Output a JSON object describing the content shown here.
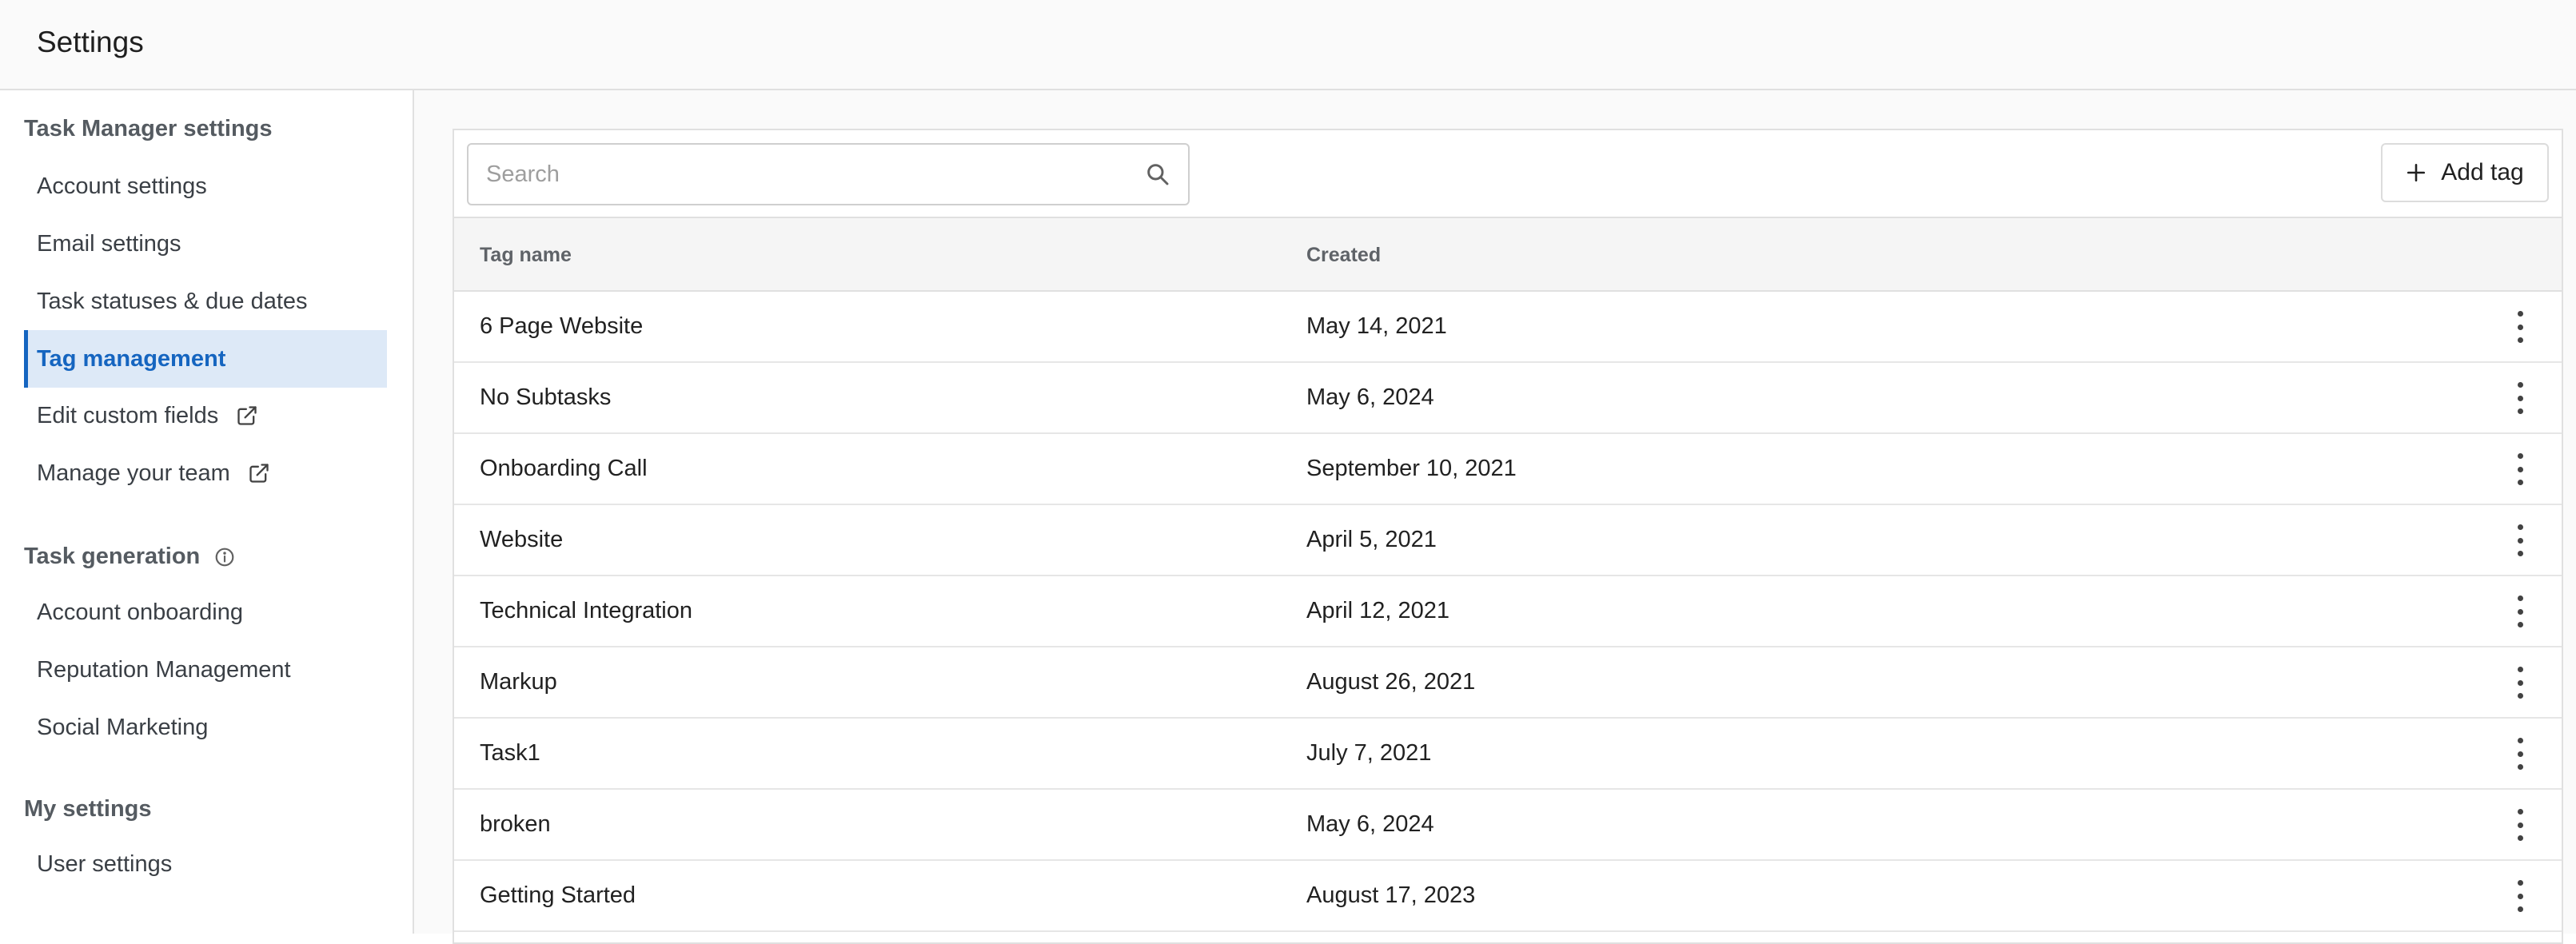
{
  "header": {
    "title": "Settings"
  },
  "sidebar": {
    "sections": [
      {
        "heading": "Task Manager settings",
        "items": [
          {
            "label": "Account settings"
          },
          {
            "label": "Email settings"
          },
          {
            "label": "Task statuses & due dates"
          },
          {
            "label": "Tag management",
            "active": true
          },
          {
            "label": "Edit custom fields",
            "icon": "external-link-icon"
          },
          {
            "label": "Manage your team",
            "icon": "external-link-icon"
          }
        ]
      },
      {
        "heading": "Task generation",
        "heading_icon": "info-icon",
        "items": [
          {
            "label": "Account onboarding"
          },
          {
            "label": "Reputation Management"
          },
          {
            "label": "Social Marketing"
          }
        ]
      },
      {
        "heading": "My settings",
        "items": [
          {
            "label": "User settings"
          }
        ]
      }
    ]
  },
  "toolbar": {
    "search_placeholder": "Search",
    "search_value": "",
    "add_label": "Add tag"
  },
  "table": {
    "columns": [
      "Tag name",
      "Created"
    ],
    "rows": [
      {
        "name": "6 Page Website",
        "created": "May 14, 2021"
      },
      {
        "name": "No Subtasks",
        "created": "May 6, 2024"
      },
      {
        "name": "Onboarding Call",
        "created": "September 10, 2021"
      },
      {
        "name": "Website",
        "created": "April 5, 2021"
      },
      {
        "name": "Technical Integration",
        "created": "April 12, 2021"
      },
      {
        "name": "Markup",
        "created": "August 26, 2021"
      },
      {
        "name": "Task1",
        "created": "July 7, 2021"
      },
      {
        "name": "broken",
        "created": "May 6, 2024"
      },
      {
        "name": "Getting Started",
        "created": "August 17, 2023"
      }
    ]
  },
  "colors": {
    "accent": "#1565c0",
    "active_bg": "#dde9f7",
    "header_bg": "#fafafa",
    "table_header_bg": "#f5f5f5"
  },
  "icons": {
    "search": "search-icon",
    "add": "plus-icon",
    "row_menu": "more-vertical-icon",
    "external": "external-link-icon",
    "info": "info-icon"
  }
}
